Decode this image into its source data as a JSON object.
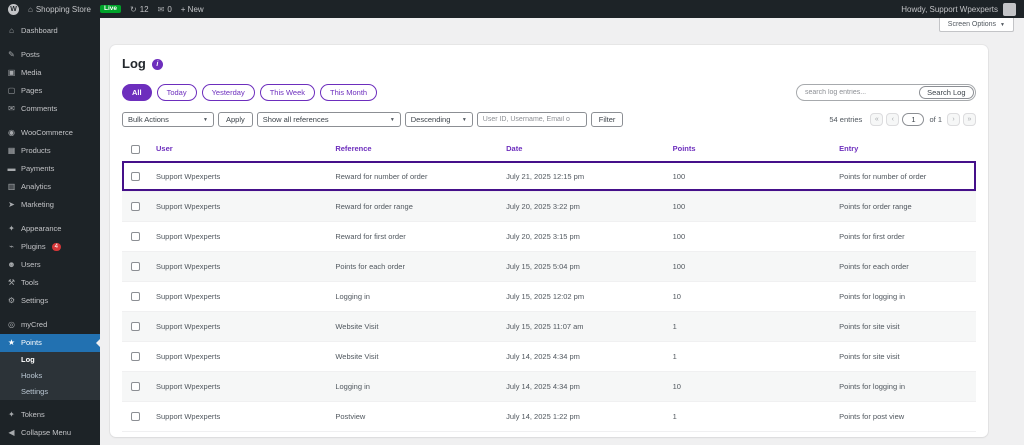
{
  "admin_bar": {
    "wp_logo": "W",
    "home_icon": "⌂",
    "site_name": "Shopping Store",
    "live_badge": "Live",
    "updates_icon": "↻",
    "updates_count": "12",
    "comments_icon": "✉",
    "comments_count": "0",
    "new_label": "+ New",
    "howdy": "Howdy, Support Wpexperts"
  },
  "sidebar": {
    "items": [
      {
        "label": "Dashboard",
        "icon": "⌂",
        "_name": "sidebar-item-dashboard"
      },
      {
        "_class": "sep"
      },
      {
        "label": "Posts",
        "icon": "✎",
        "_name": "sidebar-item-posts"
      },
      {
        "label": "Media",
        "icon": "▣",
        "_name": "sidebar-item-media"
      },
      {
        "label": "Pages",
        "icon": "▢",
        "_name": "sidebar-item-pages"
      },
      {
        "label": "Comments",
        "icon": "✉",
        "_name": "sidebar-item-comments"
      },
      {
        "_class": "sep"
      },
      {
        "label": "WooCommerce",
        "icon": "◉",
        "_name": "sidebar-item-woocommerce"
      },
      {
        "label": "Products",
        "icon": "▦",
        "_name": "sidebar-item-products"
      },
      {
        "label": "Payments",
        "icon": "▬",
        "_name": "sidebar-item-payments"
      },
      {
        "label": "Analytics",
        "icon": "▥",
        "_name": "sidebar-item-analytics"
      },
      {
        "label": "Marketing",
        "icon": "➤",
        "_name": "sidebar-item-marketing"
      },
      {
        "_class": "sep"
      },
      {
        "label": "Appearance",
        "icon": "✦",
        "_name": "sidebar-item-appearance"
      },
      {
        "label": "Plugins",
        "icon": "⌁",
        "badge": "4",
        "_name": "sidebar-item-plugins"
      },
      {
        "label": "Users",
        "icon": "☻",
        "_name": "sidebar-item-users"
      },
      {
        "label": "Tools",
        "icon": "⚒",
        "_name": "sidebar-item-tools"
      },
      {
        "label": "Settings",
        "icon": "⚙",
        "_name": "sidebar-item-settings"
      },
      {
        "_class": "sep"
      },
      {
        "label": "myCred",
        "icon": "◎",
        "_name": "sidebar-item-mycred"
      },
      {
        "label": "Points",
        "icon": "★",
        "_class": "active",
        "_name": "sidebar-item-points"
      },
      {
        "label": "Log",
        "_class": "submenu active-sub",
        "_name": "sidebar-subitem-log"
      },
      {
        "label": "Hooks",
        "_class": "submenu",
        "_name": "sidebar-subitem-hooks"
      },
      {
        "label": "Settings",
        "_class": "submenu",
        "_name": "sidebar-subitem-settings"
      },
      {
        "_class": "sep"
      },
      {
        "label": "Tokens",
        "icon": "✦",
        "_name": "sidebar-item-tokens"
      },
      {
        "label": "Collapse Menu",
        "icon": "◀",
        "_name": "sidebar-item-collapse-menu"
      }
    ]
  },
  "screen_options": {
    "label": "Screen Options",
    "chevron": "▼"
  },
  "page": {
    "title": "Log",
    "info_icon": "i"
  },
  "filters": {
    "pills": [
      {
        "label": "All",
        "_class": "active",
        "_name": "pill-all"
      },
      {
        "label": "Today",
        "_name": "pill-today"
      },
      {
        "label": "Yesterday",
        "_name": "pill-yesterday"
      },
      {
        "label": "This Week",
        "_name": "pill-this-week"
      },
      {
        "label": "This Month",
        "_name": "pill-this-month"
      }
    ],
    "search_placeholder": "search log entries...",
    "search_button": "Search Log",
    "bulk_actions": "Bulk Actions",
    "apply": "Apply",
    "references": "Show all references",
    "order": "Descending",
    "user_filter_placeholder": "User ID, Username, Email o",
    "filter_button": "Filter",
    "select_chevron": "▼"
  },
  "pagination": {
    "count": "54 entries",
    "first": "«",
    "prev": "‹",
    "page": "1",
    "of": "of 1",
    "next": "›",
    "last": "»"
  },
  "table": {
    "headers": [
      "User",
      "Reference",
      "Date",
      "Points",
      "Entry"
    ],
    "rows": [
      {
        "user": "Support Wpexperts",
        "reference": "Reward for number of order",
        "date": "July 21, 2025 12:15 pm",
        "points": "100",
        "entry": "Points for number of order",
        "_class": "highlight"
      },
      {
        "user": "Support Wpexperts",
        "reference": "Reward for order range",
        "date": "July 20, 2025 3:22 pm",
        "points": "100",
        "entry": "Points for order range"
      },
      {
        "user": "Support Wpexperts",
        "reference": "Reward for first order",
        "date": "July 20, 2025 3:15 pm",
        "points": "100",
        "entry": "Points for first order"
      },
      {
        "user": "Support Wpexperts",
        "reference": "Points for each order",
        "date": "July 15, 2025 5:04 pm",
        "points": "100",
        "entry": "Points for each order"
      },
      {
        "user": "Support Wpexperts",
        "reference": "Logging in",
        "date": "July 15, 2025 12:02 pm",
        "points": "10",
        "entry": "Points for logging in"
      },
      {
        "user": "Support Wpexperts",
        "reference": "Website Visit",
        "date": "July 15, 2025 11:07 am",
        "points": "1",
        "entry": "Points for site visit"
      },
      {
        "user": "Support Wpexperts",
        "reference": "Website Visit",
        "date": "July 14, 2025 4:34 pm",
        "points": "1",
        "entry": "Points for site visit"
      },
      {
        "user": "Support Wpexperts",
        "reference": "Logging in",
        "date": "July 14, 2025 4:34 pm",
        "points": "10",
        "entry": "Points for logging in"
      },
      {
        "user": "Support Wpexperts",
        "reference": "Postview",
        "date": "July 14, 2025 1:22 pm",
        "points": "1",
        "entry": "Points for post view"
      }
    ]
  },
  "colors": {
    "accent_purple": "#6d2ebd",
    "highlight_border": "#45108a",
    "active_menu_blue": "#2271b1",
    "plugins_badge_red": "#d63638",
    "live_badge_green": "#00a32a",
    "admin_bar_bg": "#1d2327",
    "content_bg": "#f0f0f1"
  }
}
